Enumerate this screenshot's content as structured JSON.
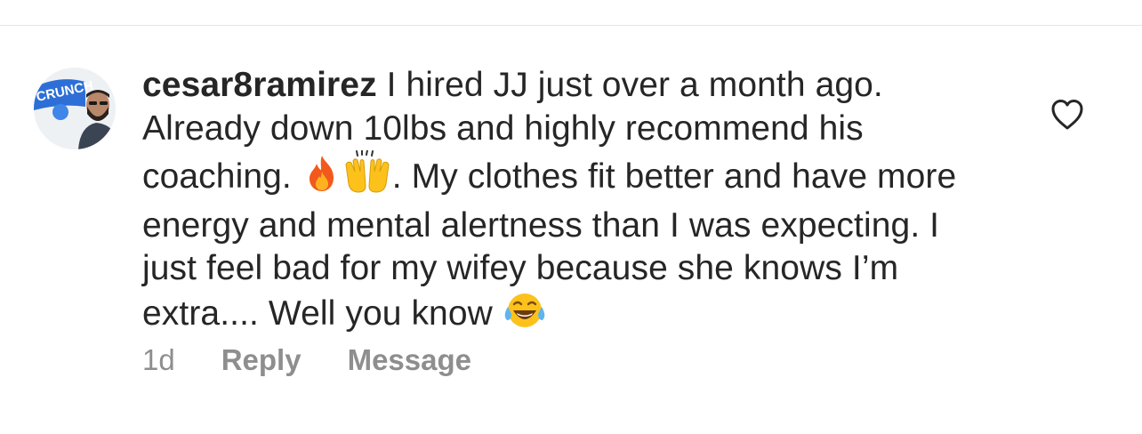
{
  "comment": {
    "username": "cesar8ramirez",
    "text_part1": " I hired JJ just over a month ago. Already down 10lbs and highly recommend his coaching. ",
    "text_part2": ". My clothes fit better and have more energy and mental alertness than I was expecting. I just feel bad for my wifey because she knows I’m extra.... Well you know ",
    "emojis": [
      "fire-emoji",
      "raising-hands-emoji",
      "tears-of-joy-emoji"
    ],
    "avatar_badge_text": "CRUNCH"
  },
  "actions": {
    "timestamp": "1d",
    "reply_label": "Reply",
    "message_label": "Message"
  },
  "colors": {
    "text": "#262626",
    "secondary": "#8e8e8e",
    "divider": "#e6e6e6"
  }
}
